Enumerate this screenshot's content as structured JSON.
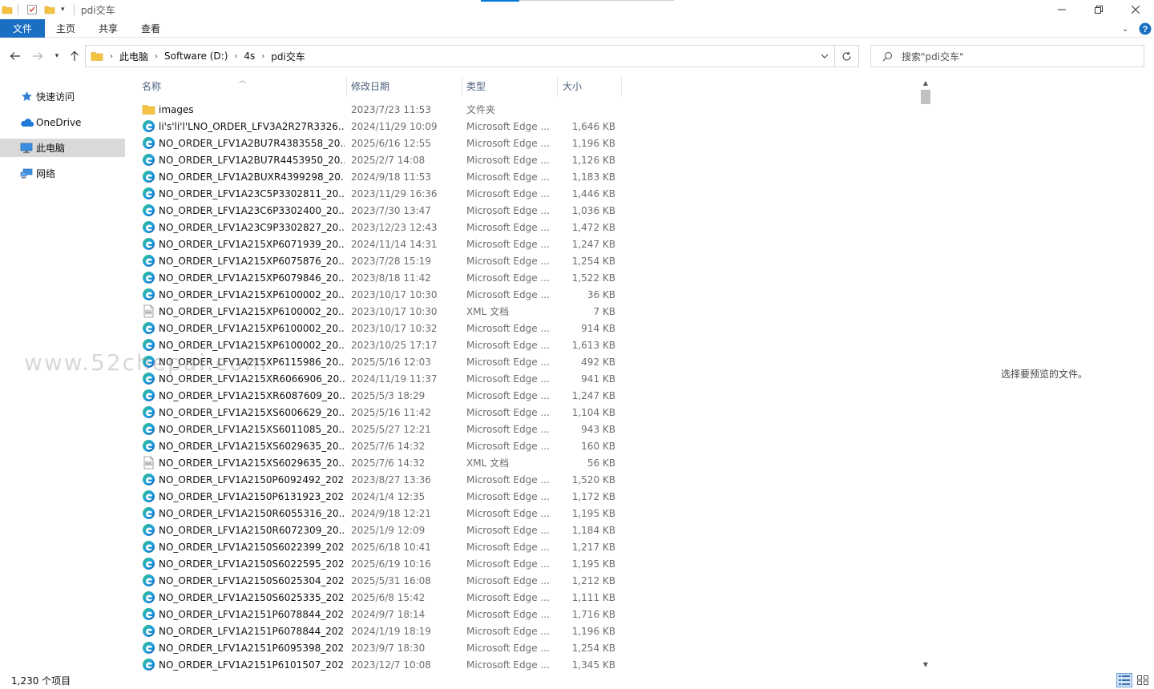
{
  "window": {
    "title": "pdi交车"
  },
  "ribbon": {
    "tabs": [
      "文件",
      "主页",
      "共享",
      "查看"
    ]
  },
  "address": {
    "crumbs": [
      "此电脑",
      "Software (D:)",
      "4s",
      "pdi交车"
    ]
  },
  "search": {
    "placeholder": "搜索\"pdi交车\""
  },
  "nav": {
    "items": [
      "快速访问",
      "OneDrive",
      "此电脑",
      "网络"
    ],
    "selected": "此电脑"
  },
  "columns": {
    "name": "名称",
    "date": "修改日期",
    "type": "类型",
    "size": "大小"
  },
  "files": [
    {
      "icon": "folder",
      "name": "images",
      "date": "2023/7/23 11:53",
      "type": "文件夹",
      "size": ""
    },
    {
      "icon": "edge",
      "name": "li's'li'l'LNO_ORDER_LFV3A2R27R3326...",
      "date": "2024/11/29 10:09",
      "type": "Microsoft Edge ...",
      "size": "1,646 KB"
    },
    {
      "icon": "edge",
      "name": "NO_ORDER_LFV1A2BU7R4383558_20...",
      "date": "2025/6/16 12:55",
      "type": "Microsoft Edge ...",
      "size": "1,196 KB"
    },
    {
      "icon": "edge",
      "name": "NO_ORDER_LFV1A2BU7R4453950_20...",
      "date": "2025/2/7 14:08",
      "type": "Microsoft Edge ...",
      "size": "1,126 KB"
    },
    {
      "icon": "edge",
      "name": "NO_ORDER_LFV1A2BUXR4399298_20...",
      "date": "2024/9/18 11:53",
      "type": "Microsoft Edge ...",
      "size": "1,183 KB"
    },
    {
      "icon": "edge",
      "name": "NO_ORDER_LFV1A23C5P3302811_20...",
      "date": "2023/11/29 16:36",
      "type": "Microsoft Edge ...",
      "size": "1,446 KB"
    },
    {
      "icon": "edge",
      "name": "NO_ORDER_LFV1A23C6P3302400_20...",
      "date": "2023/7/30 13:47",
      "type": "Microsoft Edge ...",
      "size": "1,036 KB"
    },
    {
      "icon": "edge",
      "name": "NO_ORDER_LFV1A23C9P3302827_20...",
      "date": "2023/12/23 12:43",
      "type": "Microsoft Edge ...",
      "size": "1,472 KB"
    },
    {
      "icon": "edge",
      "name": "NO_ORDER_LFV1A215XP6071939_20...",
      "date": "2024/11/14 14:31",
      "type": "Microsoft Edge ...",
      "size": "1,247 KB"
    },
    {
      "icon": "edge",
      "name": "NO_ORDER_LFV1A215XP6075876_20...",
      "date": "2023/7/28 15:19",
      "type": "Microsoft Edge ...",
      "size": "1,254 KB"
    },
    {
      "icon": "edge",
      "name": "NO_ORDER_LFV1A215XP6079846_20...",
      "date": "2023/8/18 11:42",
      "type": "Microsoft Edge ...",
      "size": "1,522 KB"
    },
    {
      "icon": "edge",
      "name": "NO_ORDER_LFV1A215XP6100002_20...",
      "date": "2023/10/17 10:30",
      "type": "Microsoft Edge ...",
      "size": "36 KB"
    },
    {
      "icon": "xml",
      "name": "NO_ORDER_LFV1A215XP6100002_20...",
      "date": "2023/10/17 10:30",
      "type": "XML 文档",
      "size": "7 KB"
    },
    {
      "icon": "edge",
      "name": "NO_ORDER_LFV1A215XP6100002_20...",
      "date": "2023/10/17 10:32",
      "type": "Microsoft Edge ...",
      "size": "914 KB"
    },
    {
      "icon": "edge",
      "name": "NO_ORDER_LFV1A215XP6100002_20...",
      "date": "2023/10/25 17:17",
      "type": "Microsoft Edge ...",
      "size": "1,613 KB"
    },
    {
      "icon": "edge",
      "name": "NO_ORDER_LFV1A215XP6115986_20...",
      "date": "2025/5/16 12:03",
      "type": "Microsoft Edge ...",
      "size": "492 KB"
    },
    {
      "icon": "edge",
      "name": "NO_ORDER_LFV1A215XR6066906_20...",
      "date": "2024/11/19 11:37",
      "type": "Microsoft Edge ...",
      "size": "941 KB"
    },
    {
      "icon": "edge",
      "name": "NO_ORDER_LFV1A215XR6087609_20...",
      "date": "2025/5/3 18:29",
      "type": "Microsoft Edge ...",
      "size": "1,247 KB"
    },
    {
      "icon": "edge",
      "name": "NO_ORDER_LFV1A215XS6006629_20...",
      "date": "2025/5/16 11:42",
      "type": "Microsoft Edge ...",
      "size": "1,104 KB"
    },
    {
      "icon": "edge",
      "name": "NO_ORDER_LFV1A215XS6011085_20...",
      "date": "2025/5/27 12:21",
      "type": "Microsoft Edge ...",
      "size": "943 KB"
    },
    {
      "icon": "edge",
      "name": "NO_ORDER_LFV1A215XS6029635_20...",
      "date": "2025/7/6 14:32",
      "type": "Microsoft Edge ...",
      "size": "160 KB"
    },
    {
      "icon": "xml",
      "name": "NO_ORDER_LFV1A215XS6029635_20...",
      "date": "2025/7/6 14:32",
      "type": "XML 文档",
      "size": "56 KB"
    },
    {
      "icon": "edge",
      "name": "NO_ORDER_LFV1A2150P6092492_202...",
      "date": "2023/8/27 13:36",
      "type": "Microsoft Edge ...",
      "size": "1,520 KB"
    },
    {
      "icon": "edge",
      "name": "NO_ORDER_LFV1A2150P6131923_202...",
      "date": "2024/1/4 12:35",
      "type": "Microsoft Edge ...",
      "size": "1,172 KB"
    },
    {
      "icon": "edge",
      "name": "NO_ORDER_LFV1A2150R6055316_20...",
      "date": "2024/9/18 12:21",
      "type": "Microsoft Edge ...",
      "size": "1,195 KB"
    },
    {
      "icon": "edge",
      "name": "NO_ORDER_LFV1A2150R6072309_20...",
      "date": "2025/1/9 12:09",
      "type": "Microsoft Edge ...",
      "size": "1,184 KB"
    },
    {
      "icon": "edge",
      "name": "NO_ORDER_LFV1A2150S6022399_202...",
      "date": "2025/6/18 10:41",
      "type": "Microsoft Edge ...",
      "size": "1,217 KB"
    },
    {
      "icon": "edge",
      "name": "NO_ORDER_LFV1A2150S6022595_202...",
      "date": "2025/6/19 10:16",
      "type": "Microsoft Edge ...",
      "size": "1,195 KB"
    },
    {
      "icon": "edge",
      "name": "NO_ORDER_LFV1A2150S6025304_202...",
      "date": "2025/5/31 16:08",
      "type": "Microsoft Edge ...",
      "size": "1,212 KB"
    },
    {
      "icon": "edge",
      "name": "NO_ORDER_LFV1A2150S6025335_202...",
      "date": "2025/6/8 15:42",
      "type": "Microsoft Edge ...",
      "size": "1,111 KB"
    },
    {
      "icon": "edge",
      "name": "NO_ORDER_LFV1A2151P6078844_202...",
      "date": "2024/9/7 18:14",
      "type": "Microsoft Edge ...",
      "size": "1,716 KB"
    },
    {
      "icon": "edge",
      "name": "NO_ORDER_LFV1A2151P6078844_202...",
      "date": "2024/1/19 18:19",
      "type": "Microsoft Edge ...",
      "size": "1,196 KB"
    },
    {
      "icon": "edge",
      "name": "NO_ORDER_LFV1A2151P6095398_202...",
      "date": "2023/9/7 18:30",
      "type": "Microsoft Edge ...",
      "size": "1,254 KB"
    },
    {
      "icon": "edge",
      "name": "NO_ORDER_LFV1A2151P6101507_202...",
      "date": "2023/12/7 10:08",
      "type": "Microsoft Edge ...",
      "size": "1,345 KB"
    }
  ],
  "preview": {
    "message": "选择要预览的文件。"
  },
  "status": {
    "count": "1,230 个项目"
  },
  "watermark": "www.52chepai.com",
  "colors": {
    "accent": "#0078d7",
    "file_tab": "#1a6fc2",
    "nav_selected": "#d9d9d9"
  }
}
